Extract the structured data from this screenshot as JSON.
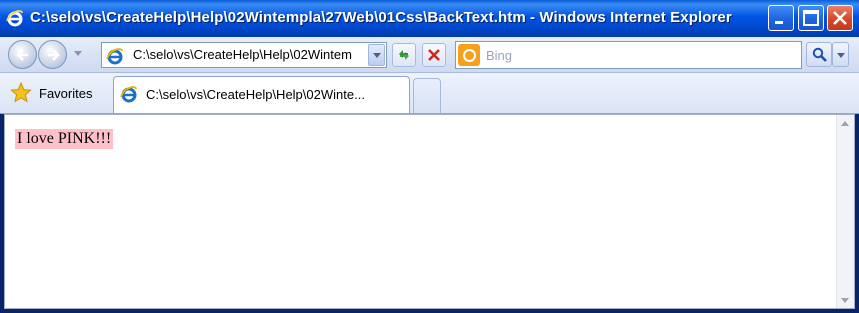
{
  "window": {
    "title": "C:\\selo\\vs\\CreateHelp\\Help\\02Wintempla\\27Web\\01Css\\BackText.htm - Windows Internet Explorer"
  },
  "navbar": {
    "address_value": "C:\\selo\\vs\\CreateHelp\\Help\\02Wintem",
    "search_placeholder": "Bing"
  },
  "tabs": {
    "favorites_label": "Favorites",
    "active_tab_label": "C:\\selo\\vs\\CreateHelp\\Help\\02Winte..."
  },
  "page": {
    "text": "I love PINK!!!",
    "highlight_color": "#ffc0cb"
  },
  "colors": {
    "titlebar": "#0054e3",
    "close_button": "#d6482c"
  },
  "icons": [
    "ie-icon",
    "minimize-icon",
    "maximize-icon",
    "close-icon",
    "back-arrow-icon",
    "forward-arrow-icon",
    "refresh-icon",
    "stop-icon",
    "bing-icon",
    "search-icon",
    "star-icon"
  ]
}
